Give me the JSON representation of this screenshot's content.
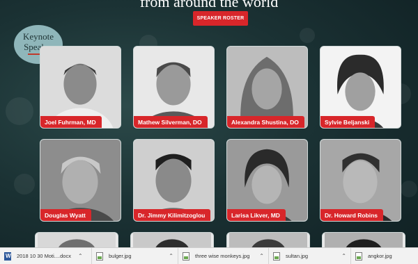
{
  "page": {
    "title_fragment": "from around the world"
  },
  "roster_button": {
    "label": "SPEAKER ROSTER"
  },
  "badge": {
    "line1": "Keynote",
    "line2": "Speaker"
  },
  "speakers": [
    {
      "name": "Joel Fuhrman, MD"
    },
    {
      "name": "Mathew Silverman, DO"
    },
    {
      "name": "Alexandra Shustina, DO"
    },
    {
      "name": "Sylvie Beljanski"
    },
    {
      "name": "Douglas Wyatt"
    },
    {
      "name": "Dr. Jimmy Kilimitzoglou"
    },
    {
      "name": "Larisa Likver, MD"
    },
    {
      "name": "Dr. Howard Robins"
    }
  ],
  "downloads": [
    {
      "name": "2018 10 30 Moti....docx",
      "icon": "word-file-icon"
    },
    {
      "name": "bulger.jpg",
      "icon": "image-file-icon"
    },
    {
      "name": "three wise monkeys.jpg",
      "icon": "image-file-icon"
    },
    {
      "name": "sultan.jpg",
      "icon": "image-file-icon"
    },
    {
      "name": "angkor.jpg",
      "icon": "image-file-icon"
    }
  ],
  "colors": {
    "accent": "#d8262a",
    "background": "#1b3234",
    "badge": "#8fb6ba"
  }
}
